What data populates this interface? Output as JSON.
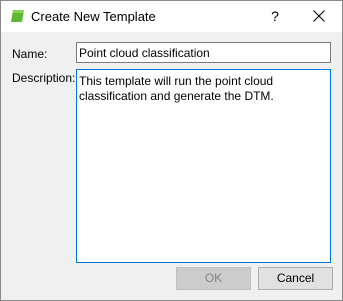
{
  "window": {
    "title": "Create New Template",
    "help_label": "?",
    "app_icon": "green-template-icon",
    "close_icon": "close-icon",
    "accent_color": "#5fb832"
  },
  "form": {
    "name_label": "Name:",
    "name_value": "Point cloud classification",
    "description_label": "Description:",
    "description_value": "This template will run the point cloud classification and generate the DTM."
  },
  "buttons": {
    "ok_label": "OK",
    "ok_enabled": false,
    "cancel_label": "Cancel"
  }
}
